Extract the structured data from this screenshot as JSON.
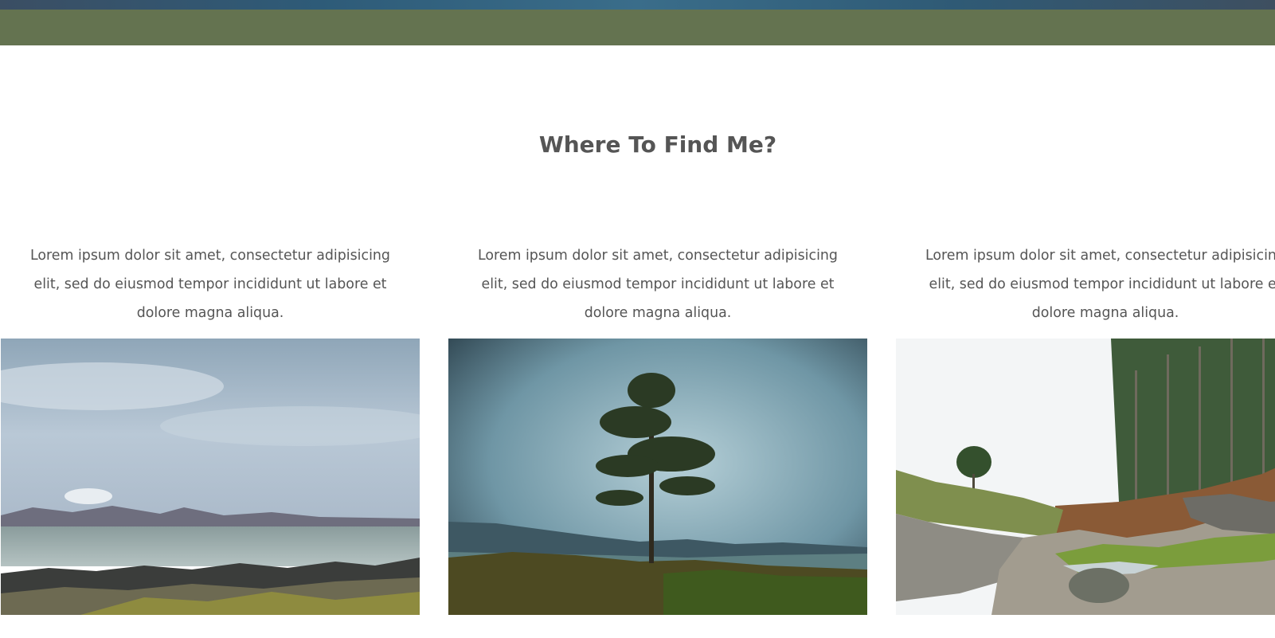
{
  "header": {
    "banner_colors": [
      "#3b4e63",
      "#2e5b78",
      "#3a6d8a"
    ],
    "nav_color": "#647350"
  },
  "section": {
    "title": "Where To Find Me?"
  },
  "columns": [
    {
      "line1": "Lorem ipsum dolor sit amet, consectetur adipisicing",
      "line2": "elit, sed do eiusmod tempor incididunt ut labore et",
      "line3": "dolore magna aliqua."
    },
    {
      "line1": "Lorem ipsum dolor sit amet, consectetur adipisicing",
      "line2": "elit, sed do eiusmod tempor incididunt ut labore et",
      "line3": "dolore magna aliqua."
    },
    {
      "line1": "Lorem ipsum dolor sit amet, consectetur adipisicing",
      "line2": "elit, sed do eiusmod tempor incididunt ut labore et",
      "line3": "dolore magna aliqua."
    }
  ],
  "photos": [
    {
      "subject": "coastal-landscape"
    },
    {
      "subject": "lone-pine-tree"
    },
    {
      "subject": "rocky-stream-forest"
    }
  ]
}
